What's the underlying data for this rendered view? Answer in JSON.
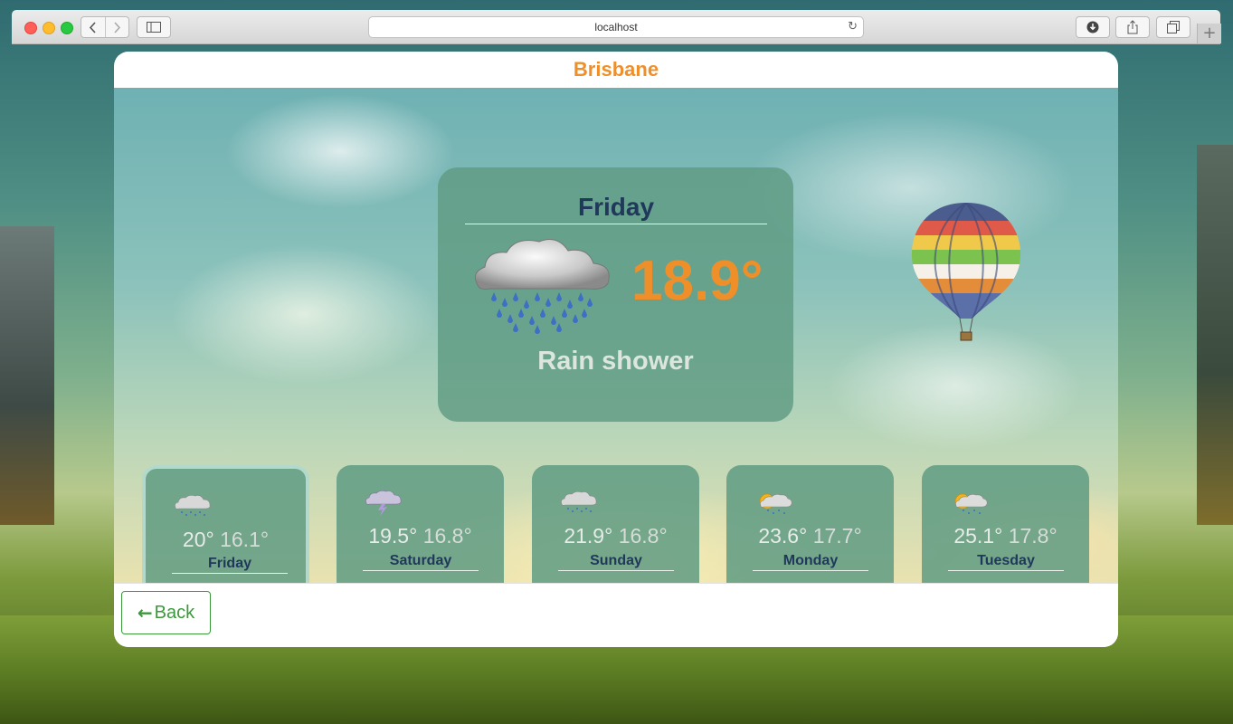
{
  "browser": {
    "url": "localhost",
    "new_tab_label": "+"
  },
  "app": {
    "city": "Brisbane"
  },
  "current": {
    "day": "Friday",
    "temperature": "18.9°",
    "condition": "Rain shower",
    "icon": "rain-cloud-icon"
  },
  "forecast": [
    {
      "day": "Friday",
      "high": "20°",
      "low": "16.1°",
      "icon": "rain-cloud-icon",
      "selected": true
    },
    {
      "day": "Saturday",
      "high": "19.5°",
      "low": "16.8°",
      "icon": "thunderstorm-icon",
      "selected": false
    },
    {
      "day": "Sunday",
      "high": "21.9°",
      "low": "16.8°",
      "icon": "rain-cloud-icon",
      "selected": false
    },
    {
      "day": "Monday",
      "high": "23.6°",
      "low": "17.7°",
      "icon": "sun-rain-icon",
      "selected": false
    },
    {
      "day": "Tuesday",
      "high": "25.1°",
      "low": "17.8°",
      "icon": "sun-rain-icon",
      "selected": false
    }
  ],
  "footer": {
    "back_label": "Back"
  },
  "colors": {
    "accent_orange": "#ef8f2a",
    "dark_blue": "#20385a",
    "panel_green": "#5f9b82",
    "button_green": "#3a9a3a"
  }
}
